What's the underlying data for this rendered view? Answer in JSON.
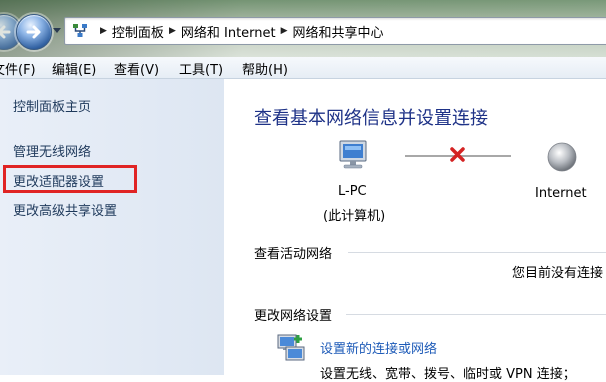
{
  "address": {
    "breadcrumbs": [
      "控制面板",
      "网络和 Internet",
      "网络和共享中心"
    ]
  },
  "menu": [
    "文件(F)",
    "编辑(E)",
    "查看(V)",
    "工具(T)",
    "帮助(H)"
  ],
  "sidebar": {
    "items": [
      {
        "label": "控制面板主页"
      },
      {
        "label": "管理无线网络"
      },
      {
        "label": "更改适配器设置"
      },
      {
        "label": "更改高级共享设置"
      }
    ]
  },
  "main": {
    "title": "查看基本网络信息并设置连接",
    "map": {
      "computer_name": "L-PC",
      "computer_sub": "(此计算机)",
      "internet_label": "Internet"
    },
    "active_networks": {
      "heading": "查看活动网络",
      "status": "您目前没有连接"
    },
    "change_settings": {
      "heading": "更改网络设置",
      "task_link": "设置新的连接或网络",
      "task_desc": "设置无线、宽带、拨号、临时或 VPN 连接；"
    }
  },
  "colors": {
    "link": "#1e5bb8",
    "title": "#1e3287",
    "highlight": "#e02424",
    "disconnected": "#d42323"
  }
}
